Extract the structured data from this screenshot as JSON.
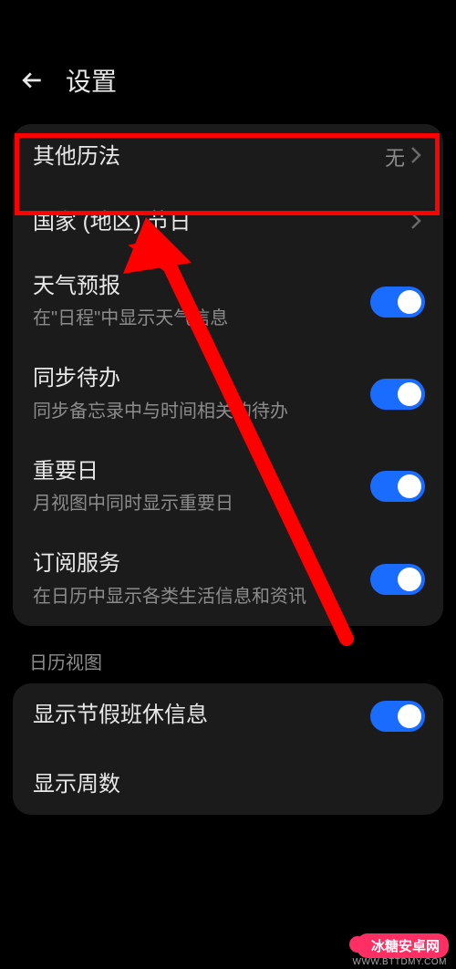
{
  "header": {
    "title": "设置"
  },
  "rows": {
    "other_calendars": {
      "title": "其他历法",
      "value": "无"
    },
    "region_holidays": {
      "title": "国家 (地区) 节日"
    },
    "weather": {
      "title": "天气预报",
      "sub": "在\"日程\"中显示天气信息"
    },
    "sync_todo": {
      "title": "同步待办",
      "sub": "同步备忘录中与时间相关的待办"
    },
    "important_days": {
      "title": "重要日",
      "sub": "月视图中同时显示重要日"
    },
    "subscribe": {
      "title": "订阅服务",
      "sub": "在日历中显示各类生活信息和资讯"
    }
  },
  "section_labels": {
    "calendar_view": "日历视图"
  },
  "panel2": {
    "holiday_info": {
      "title": "显示节假班休信息"
    },
    "week_numbers": {
      "title": "显示周数"
    }
  },
  "watermark": {
    "brand": "冰糖安卓网",
    "url": "WWW.BTTDMY.COM"
  }
}
